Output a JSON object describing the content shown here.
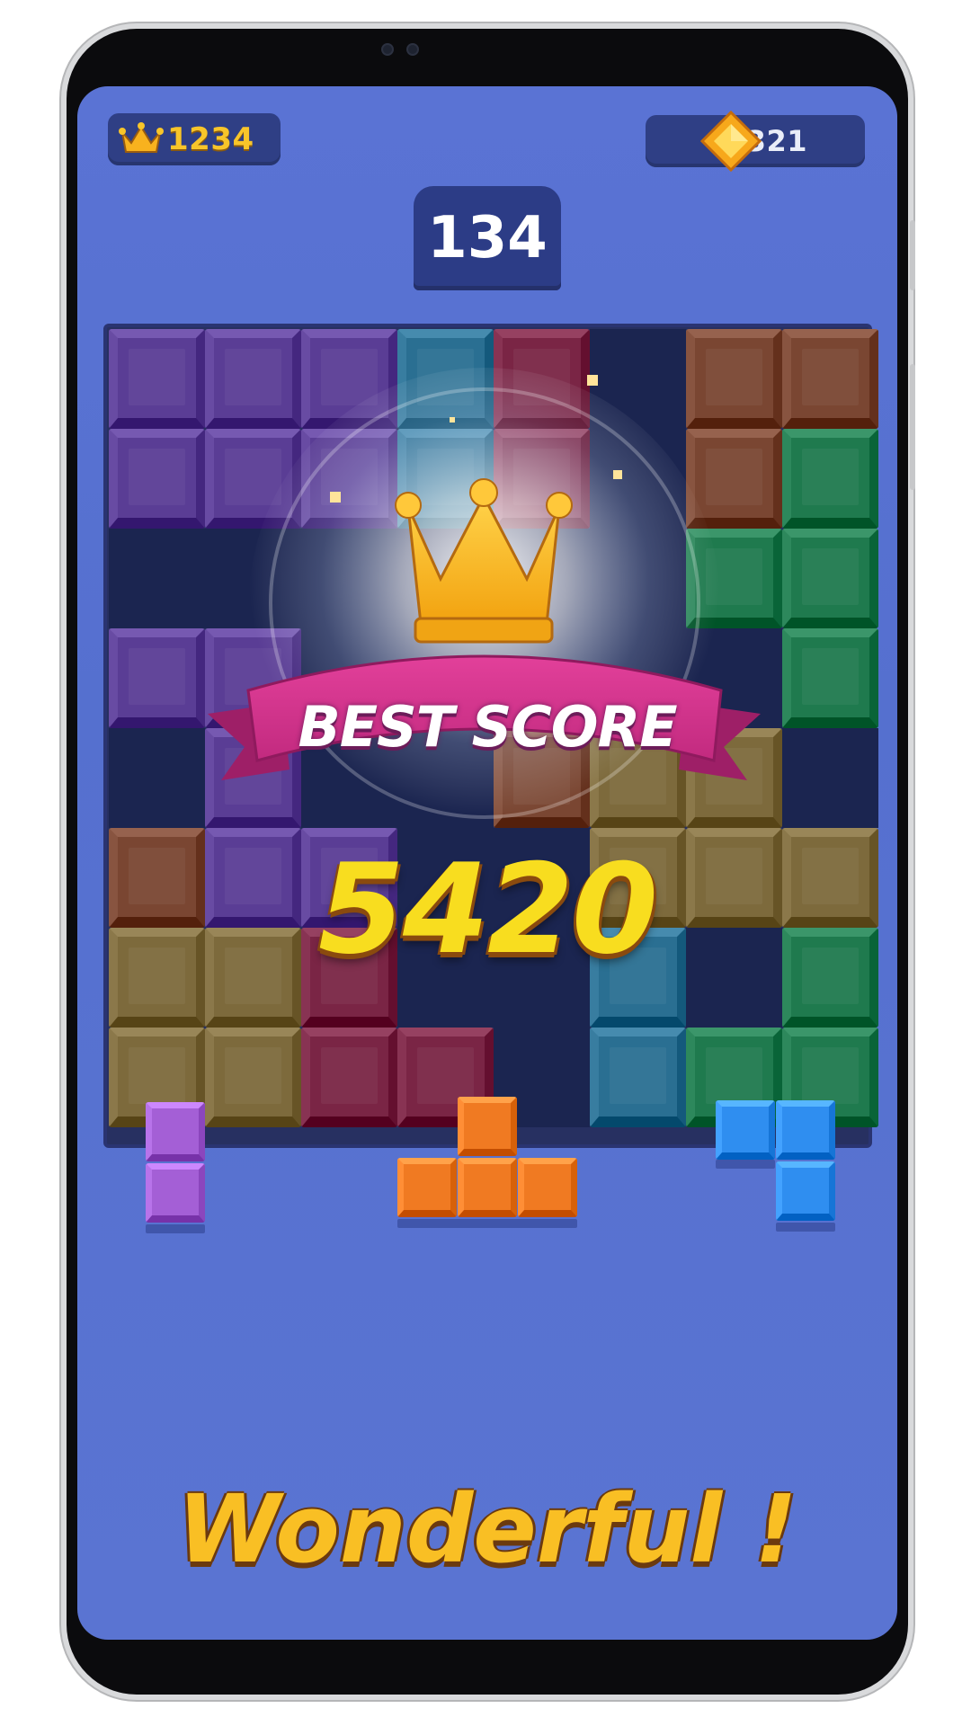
{
  "hud": {
    "best_icon": "crown-icon",
    "best_value": "1234",
    "gem_icon": "diamond-icon",
    "gem_value": "321",
    "current_score": "134"
  },
  "board": {
    "columns": 8,
    "rows": 8,
    "grid": [
      [
        "purple",
        "purple",
        "purple",
        "teal",
        "red",
        "empty",
        "brown",
        "brown"
      ],
      [
        "purple",
        "purple",
        "purple",
        "teal",
        "red",
        "empty",
        "brown",
        "green"
      ],
      [
        "empty",
        "empty",
        "empty",
        "empty",
        "empty",
        "empty",
        "green",
        "green"
      ],
      [
        "purple",
        "purple",
        "empty",
        "empty",
        "empty",
        "empty",
        "empty",
        "green"
      ],
      [
        "empty",
        "purple",
        "empty",
        "empty",
        "brown",
        "olive",
        "olive",
        "empty"
      ],
      [
        "brown",
        "purple",
        "purple",
        "empty",
        "empty",
        "olive",
        "olive",
        "olive"
      ],
      [
        "olive",
        "olive",
        "red",
        "empty",
        "empty",
        "teal",
        "empty",
        "green"
      ],
      [
        "olive",
        "olive",
        "red",
        "red",
        "empty",
        "teal",
        "green",
        "green"
      ]
    ],
    "colors": {
      "purple": "#5a3d95",
      "teal": "#2a6f92",
      "red": "#7a2545",
      "brown": "#7a4632",
      "green": "#1f7a4e",
      "olive": "#7d6a3c",
      "empty": "#1b2550"
    }
  },
  "popup": {
    "icon": "crown-icon",
    "banner_text": "BEST SCORE",
    "value": "5420"
  },
  "pieces": [
    {
      "name": "purple-vertical-domino",
      "color": "#a45fd6"
    },
    {
      "name": "orange-t-piece",
      "color": "#f07a22"
    },
    {
      "name": "blue-l-piece",
      "color": "#2f8ef0"
    }
  ],
  "message": "Wonderful !"
}
